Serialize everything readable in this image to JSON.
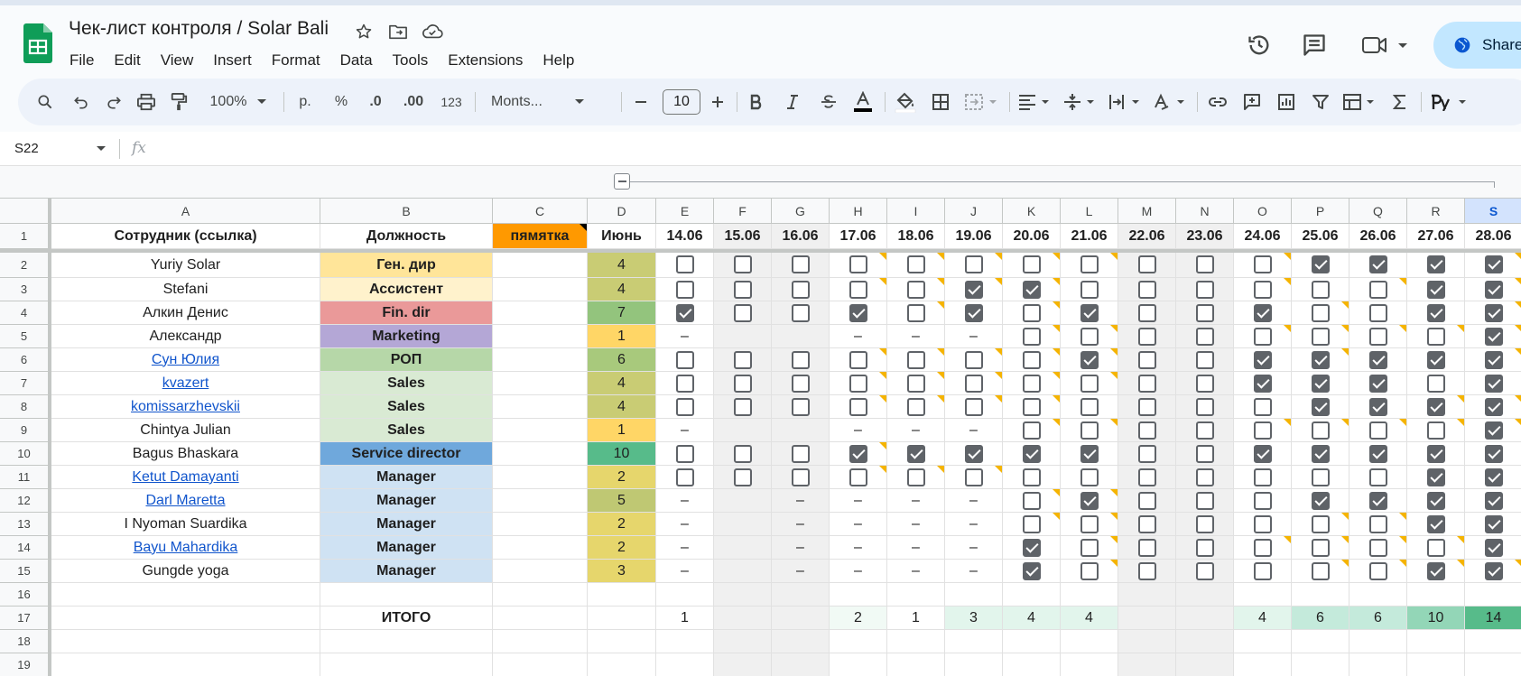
{
  "doc": {
    "title": "Чек-лист контроля / Solar Bali"
  },
  "menu": [
    "File",
    "Edit",
    "View",
    "Insert",
    "Format",
    "Data",
    "Tools",
    "Extensions",
    "Help"
  ],
  "share": {
    "label": "Share"
  },
  "toolbar": {
    "zoom": "100%",
    "currency": "р.",
    "percent": "%",
    "dec_less": ".0",
    "dec_more": ".00",
    "format123": "123",
    "font": "Monts...",
    "font_size": "10"
  },
  "formula": {
    "cell_ref": "S22",
    "fx": "fx",
    "value": ""
  },
  "colors": {
    "cb_on": "#5f6368",
    "note": "#f5b400",
    "link": "#1155cc",
    "weekend": "#f0f0f0",
    "header_selected": "#d3e3fd"
  },
  "columns": [
    "A",
    "B",
    "C",
    "D",
    "E",
    "F",
    "G",
    "H",
    "I",
    "J",
    "K",
    "L",
    "M",
    "N",
    "O",
    "P",
    "Q",
    "R",
    "S"
  ],
  "selected_column": "S",
  "header_row": {
    "employee": "Сотрудник (ссылка)",
    "position": "Должность",
    "memo": "пямятка",
    "month": "Июнь",
    "dates": [
      "14.06",
      "15.06",
      "16.06",
      "17.06",
      "18.06",
      "19.06",
      "20.06",
      "21.06",
      "22.06",
      "23.06",
      "24.06",
      "25.06",
      "26.06",
      "27.06",
      "28.06"
    ]
  },
  "rows": [
    {
      "n": "2",
      "name": "Yuriy Solar",
      "link": false,
      "pos": "Ген. дир",
      "pos_bg": "#ffe599",
      "count": "4",
      "cnt_bg": "#c9cc74",
      "marks": "CCCCCCCCCCCXXXX",
      "notes": [
        0,
        0,
        0,
        1,
        1,
        1,
        1,
        1,
        0,
        0,
        1,
        0,
        0,
        0,
        1
      ]
    },
    {
      "n": "3",
      "name": "Stefani",
      "link": false,
      "pos": "Ассистент",
      "pos_bg": "#fff2cc",
      "count": "4",
      "cnt_bg": "#c9cc74",
      "marks": "CCCCCXXCCCCCCXX",
      "notes": [
        0,
        0,
        0,
        1,
        1,
        1,
        1,
        0,
        0,
        0,
        1,
        0,
        1,
        0,
        1
      ]
    },
    {
      "n": "4",
      "name": "Алкин Денис",
      "link": false,
      "pos": "Fin. dir",
      "pos_bg": "#ea9999",
      "count": "7",
      "cnt_bg": "#93c47d",
      "marks": "XCCXCXCXCCXCCXX",
      "notes": [
        0,
        0,
        0,
        0,
        1,
        0,
        1,
        0,
        0,
        0,
        0,
        1,
        0,
        0,
        1
      ]
    },
    {
      "n": "5",
      "name": "Александр",
      "link": false,
      "pos": "Marketing",
      "pos_bg": "#b4a7d6",
      "count": "1",
      "cnt_bg": "#ffd666",
      "marks": "-..---CCCCCCCCX",
      "notes": [
        0,
        0,
        0,
        0,
        0,
        0,
        1,
        1,
        0,
        0,
        1,
        1,
        1,
        1,
        1
      ]
    },
    {
      "n": "6",
      "name": "Сун Юлия",
      "link": true,
      "pos": "РОП",
      "pos_bg": "#b6d7a8",
      "count": "6",
      "cnt_bg": "#a8c97c",
      "marks": "CCCCCCCXCCXXXXX",
      "notes": [
        0,
        0,
        0,
        1,
        1,
        1,
        1,
        1,
        0,
        0,
        0,
        1,
        0,
        0,
        1
      ]
    },
    {
      "n": "7",
      "name": "kvazert",
      "link": true,
      "pos": "Sales",
      "pos_bg": "#d9ead3",
      "count": "4",
      "cnt_bg": "#c9cc74",
      "marks": "CCCCCCCCCCXXXCX",
      "notes": [
        0,
        0,
        0,
        1,
        1,
        1,
        1,
        1,
        0,
        0,
        0,
        0,
        0,
        0,
        0
      ]
    },
    {
      "n": "8",
      "name": "komissarzhevskii",
      "link": true,
      "pos": "Sales",
      "pos_bg": "#d9ead3",
      "count": "4",
      "cnt_bg": "#c9cc74",
      "marks": "CCCCCCCCCCCXXXX",
      "notes": [
        0,
        0,
        0,
        1,
        1,
        1,
        1,
        0,
        0,
        0,
        0,
        0,
        0,
        1,
        1
      ]
    },
    {
      "n": "9",
      "name": "Chintya Julian",
      "link": false,
      "pos": "Sales",
      "pos_bg": "#d9ead3",
      "count": "1",
      "cnt_bg": "#ffd666",
      "marks": "-..---CCCCCCCCX",
      "notes": [
        0,
        0,
        0,
        0,
        0,
        0,
        1,
        1,
        0,
        0,
        1,
        1,
        1,
        1,
        1
      ]
    },
    {
      "n": "10",
      "name": "Bagus Bhaskara",
      "link": false,
      "pos": "Service director",
      "pos_bg": "#6fa8dc",
      "count": "10",
      "cnt_bg": "#57bb8a",
      "marks": "CCCXXXXXCCXXXXX",
      "notes": [
        0,
        0,
        0,
        1,
        0,
        0,
        0,
        0,
        0,
        0,
        0,
        0,
        0,
        0,
        0
      ]
    },
    {
      "n": "11",
      "name": "Ketut Damayanti",
      "link": true,
      "pos": "Manager",
      "pos_bg": "#cfe2f3",
      "count": "2",
      "cnt_bg": "#e6d66c",
      "marks": "CCCCCCCCCCCCCXX",
      "notes": [
        0,
        0,
        0,
        1,
        1,
        1,
        0,
        0,
        0,
        0,
        0,
        0,
        0,
        0,
        0
      ]
    },
    {
      "n": "12",
      "name": "Darl Maretta",
      "link": true,
      "pos": "Manager",
      "pos_bg": "#cfe2f3",
      "count": "5",
      "cnt_bg": "#bfc873",
      "marks": "-.----CXCCCXXXX",
      "notes": [
        0,
        0,
        0,
        0,
        0,
        0,
        1,
        1,
        0,
        0,
        0,
        0,
        0,
        0,
        0
      ]
    },
    {
      "n": "13",
      "name": "I Nyoman Suardika",
      "link": false,
      "pos": "Manager",
      "pos_bg": "#cfe2f3",
      "count": "2",
      "cnt_bg": "#e6d66c",
      "marks": "-.----CCCCCCCXX",
      "notes": [
        0,
        0,
        0,
        0,
        0,
        0,
        1,
        1,
        0,
        0,
        0,
        1,
        1,
        0,
        0
      ]
    },
    {
      "n": "14",
      "name": "Bayu Mahardika",
      "link": true,
      "pos": "Manager",
      "pos_bg": "#cfe2f3",
      "count": "2",
      "cnt_bg": "#e6d66c",
      "marks": "-.----XCCCCCCCX",
      "notes": [
        0,
        0,
        0,
        0,
        0,
        0,
        0,
        1,
        0,
        0,
        1,
        1,
        1,
        1,
        0
      ]
    },
    {
      "n": "15",
      "name": "Gungde yoga",
      "link": false,
      "pos": "Manager",
      "pos_bg": "#cfe2f3",
      "count": "3",
      "cnt_bg": "#e6d66c",
      "marks": "-.----XCCCCCCXX",
      "notes": [
        0,
        0,
        0,
        0,
        0,
        0,
        0,
        1,
        0,
        0,
        0,
        1,
        1,
        1,
        1
      ]
    }
  ],
  "empty_rows": [
    "16",
    "18",
    "19"
  ],
  "total_row": {
    "n": "17",
    "label": "ИТОГО",
    "values": [
      "1",
      "",
      "",
      "2",
      "1",
      "3",
      "4",
      "4",
      "",
      "",
      "4",
      "6",
      "6",
      "10",
      "14"
    ],
    "bg": [
      "#ffffff",
      "#f0f0f0",
      "#f0f0f0",
      "#f1faf5",
      "#ffffff",
      "#e2f5ec",
      "#e2f5ec",
      "#e2f5ec",
      "#f0f0f0",
      "#f0f0f0",
      "#e2f5ec",
      "#c4eadb",
      "#c4eadb",
      "#93d6b7",
      "#57bb8a"
    ]
  }
}
